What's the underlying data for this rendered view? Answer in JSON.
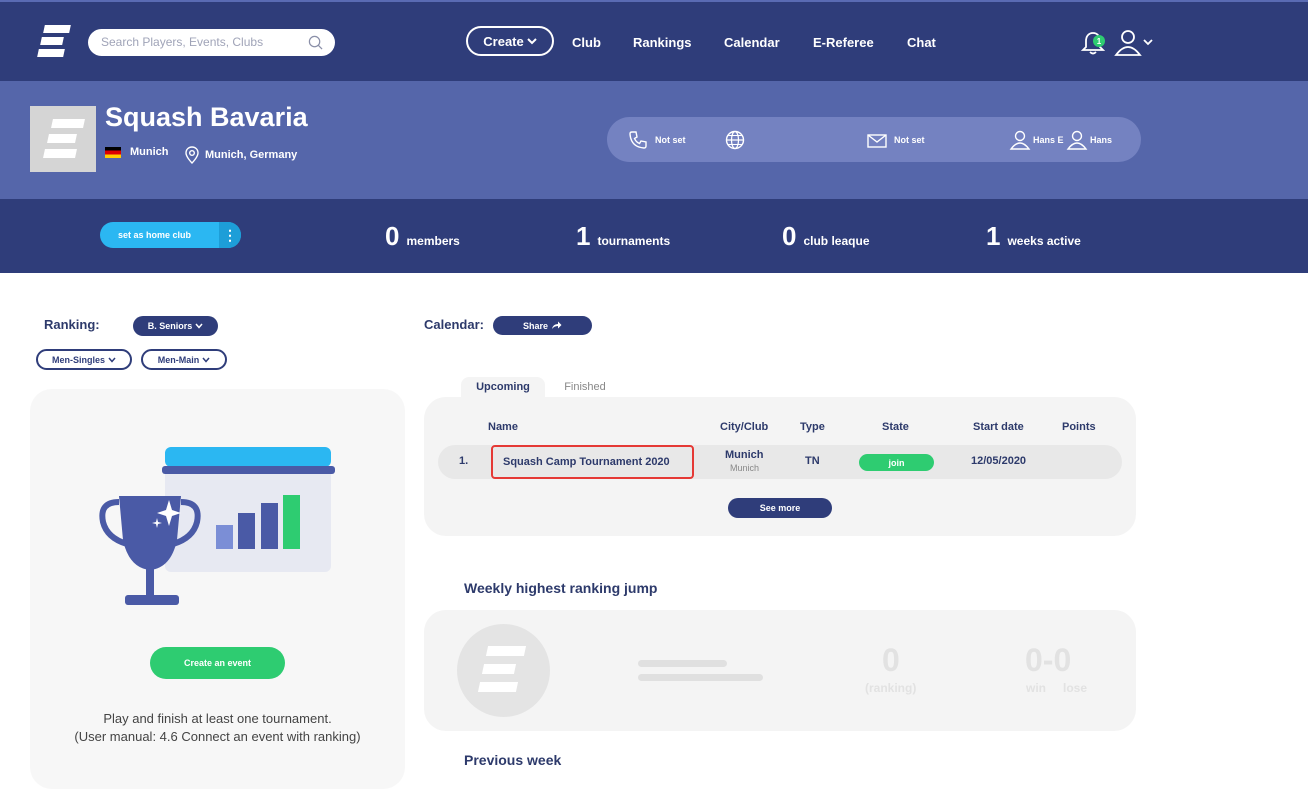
{
  "header": {
    "search_placeholder": "Search Players, Events, Clubs",
    "create_label": "Create",
    "nav": [
      "Club",
      "Rankings",
      "Calendar",
      "E-Referee",
      "Chat"
    ],
    "notification_count": "1"
  },
  "club": {
    "name": "Squash Bavaria",
    "city": "Munich",
    "location": "Munich, Germany",
    "phone": "Not set",
    "email": "Not set",
    "contact1": "Hans E",
    "contact2": "Hans"
  },
  "stats": {
    "home_club_label": "set as home club",
    "members_num": "0",
    "members_label": "members",
    "tournaments_num": "1",
    "tournaments_label": "tournaments",
    "league_num": "0",
    "league_label": "club leaque",
    "weeks_num": "1",
    "weeks_label": "weeks active"
  },
  "ranking": {
    "label": "Ranking:",
    "category": "B. Seniors",
    "discipline": "Men-Singles",
    "draw": "Men-Main",
    "create_event": "Create an event",
    "hint_line1": "Play and finish at least one tournament.",
    "hint_line2": "(User manual: 4.6 Connect an event with ranking)"
  },
  "calendar": {
    "label": "Calendar:",
    "share": "Share",
    "tabs": [
      "Upcoming",
      "Finished"
    ],
    "columns": [
      "Name",
      "City/Club",
      "Type",
      "State",
      "Start date",
      "Points"
    ],
    "row": {
      "index": "1.",
      "name": "Squash Camp Tournament 2020",
      "city": "Munich",
      "club": "Munich",
      "type": "TN",
      "state": "join",
      "start_date": "12/05/2020"
    },
    "see_more": "See more"
  },
  "weekly": {
    "title": "Weekly highest ranking jump",
    "ranking_num": "0",
    "ranking_label": "(ranking)",
    "score": "0-0",
    "win": "win",
    "lose": "lose",
    "previous_title": "Previous week"
  },
  "colors": {
    "navy": "#2f3d7a",
    "club_band": "#5566aa",
    "green": "#2ecc71",
    "blue": "#2bb7f2",
    "highlight_red": "#e53935"
  }
}
